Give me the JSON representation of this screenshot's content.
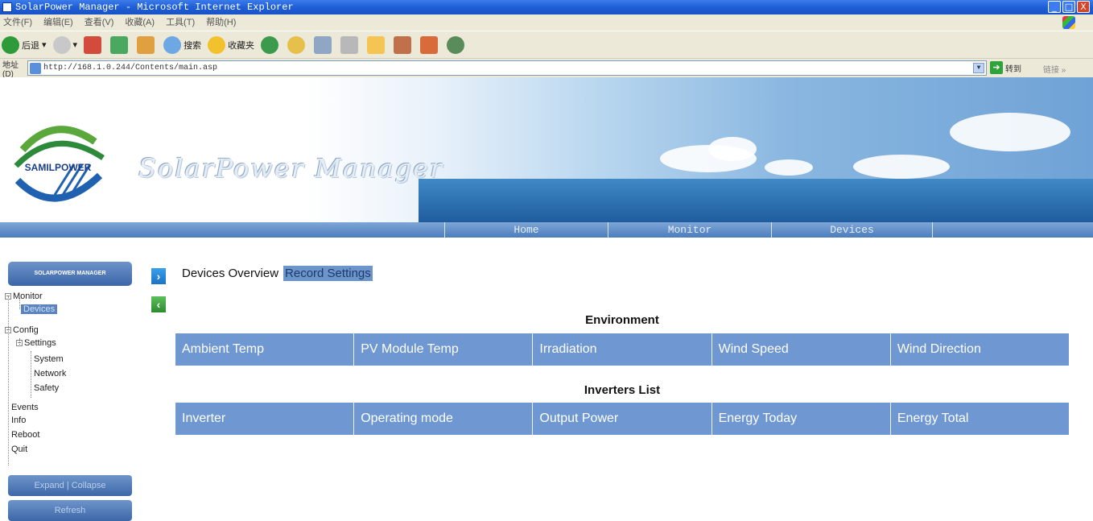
{
  "window": {
    "title": "SolarPower Manager - Microsoft Internet Explorer",
    "controls": [
      "_",
      "□",
      "X"
    ]
  },
  "menu": [
    "文件(F)",
    "编辑(E)",
    "查看(V)",
    "收藏(A)",
    "工具(T)",
    "帮助(H)"
  ],
  "toolbar": {
    "back": "后退",
    "search": "搜索",
    "favorites": "收藏夹"
  },
  "address": {
    "label": "地址(D)",
    "url": "http://168.1.0.244/Contents/main.asp",
    "go": "转到",
    "links": "链接 »"
  },
  "banner": {
    "logo_text": "SAMILPOWER",
    "brand": "SolarPower Manager"
  },
  "nav": [
    "Home",
    "Monitor",
    "Devices"
  ],
  "sidebar": {
    "header": "SOLARPOWER MANAGER",
    "tree": {
      "monitor": "Monitor",
      "devices": "Devices",
      "config": "Config",
      "settings": "Settings",
      "system": "System",
      "network": "Network",
      "safety": "Safety",
      "events": "Events",
      "info": "Info",
      "reboot": "Reboot",
      "quit": "Quit"
    },
    "expand_collapse": "Expand | Collapse",
    "refresh": "Refresh"
  },
  "main": {
    "tabs": [
      "Devices Overview",
      "Record Settings"
    ],
    "environment": {
      "title": "Environment",
      "columns": [
        "Ambient Temp",
        "PV Module Temp",
        "Irradiation",
        "Wind Speed",
        "Wind Direction"
      ]
    },
    "inverters": {
      "title": "Inverters List",
      "columns": [
        "Inverter",
        "Operating mode",
        "Output Power",
        "Energy Today",
        "Energy Total"
      ]
    }
  },
  "colors": {
    "header_blue": "#6f98d2",
    "nav_blue": "#4b7dbd",
    "title_bar": "#1f5fd6"
  }
}
